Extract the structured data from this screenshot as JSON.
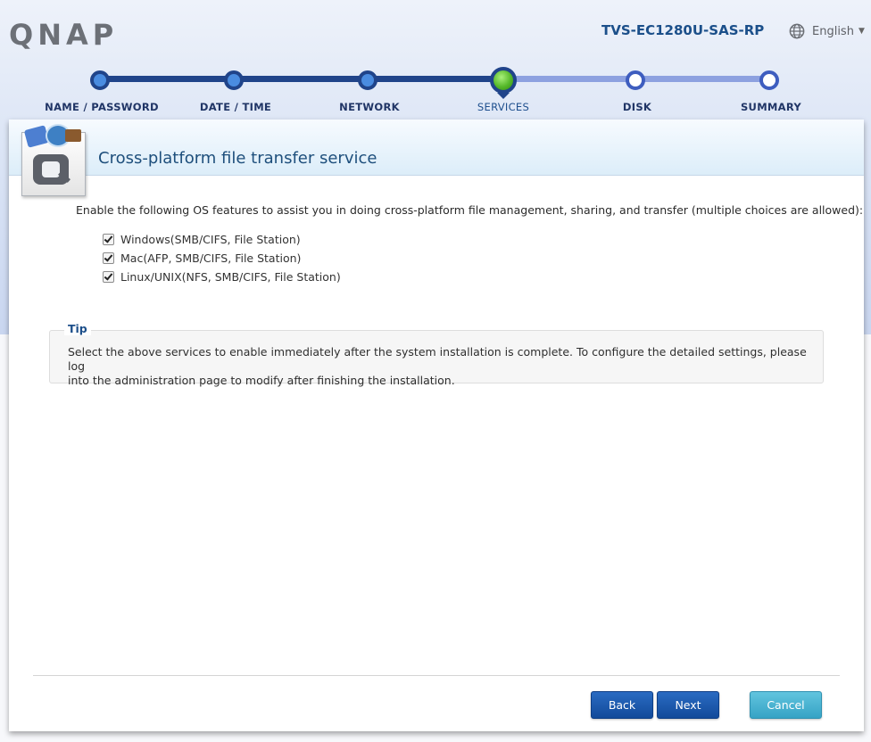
{
  "header": {
    "logo": "QNAP",
    "model": "TVS-EC1280U-SAS-RP",
    "language": {
      "label": "English",
      "icon": "globe-icon"
    }
  },
  "progress": {
    "current_index": 3,
    "steps": [
      {
        "label": "NAME / PASSWORD"
      },
      {
        "label": "DATE / TIME"
      },
      {
        "label": "NETWORK"
      },
      {
        "label": "SERVICES"
      },
      {
        "label": "DISK"
      },
      {
        "label": "SUMMARY"
      }
    ],
    "colors": {
      "done": "#20448a",
      "todo": "#8da1e0",
      "current": "#56b82a"
    }
  },
  "panel": {
    "title": "Cross-platform file transfer service",
    "description": "Enable the following OS features to assist you in doing cross-platform file management, sharing, and transfer (multiple choices are allowed):",
    "options": [
      {
        "label": "Windows(SMB/CIFS, File Station)",
        "checked": true
      },
      {
        "label": "Mac(AFP, SMB/CIFS, File Station)",
        "checked": true
      },
      {
        "label": "Linux/UNIX(NFS, SMB/CIFS, File Station)",
        "checked": true
      }
    ],
    "tip": {
      "legend": "Tip",
      "line1": "Select the above services to enable immediately after the system installation is complete. To configure the detailed settings, please log",
      "line2": "into the administration page to modify after finishing the installation."
    }
  },
  "footer": {
    "back_label": "Back",
    "next_label": "Next",
    "cancel_label": "Cancel"
  }
}
